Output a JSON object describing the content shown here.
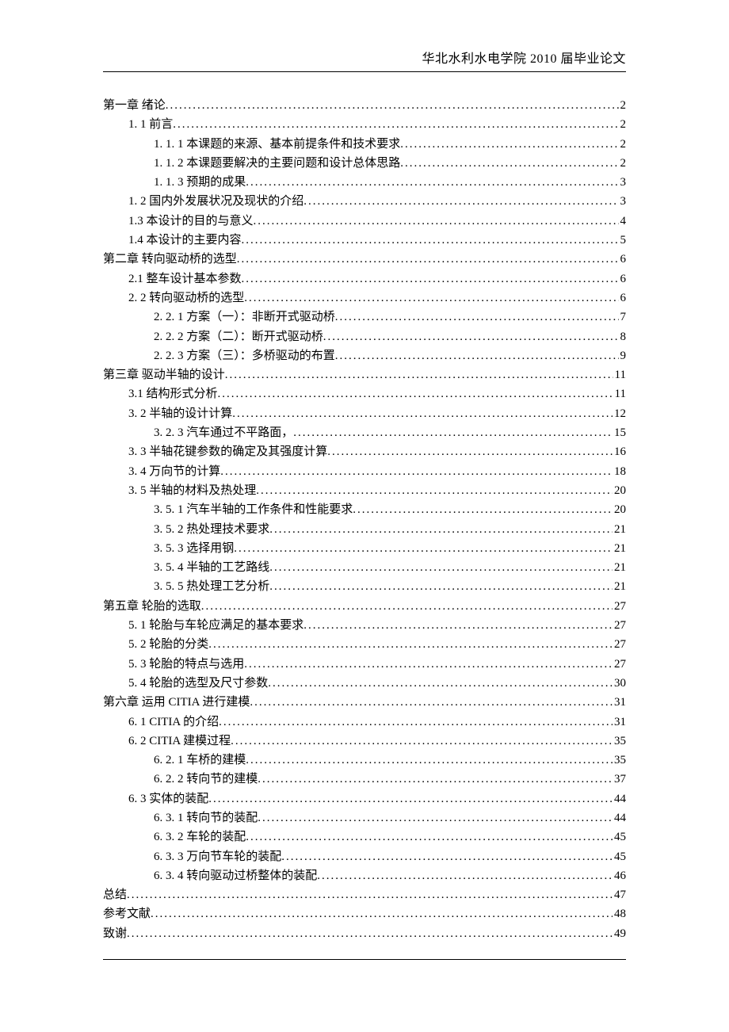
{
  "header": "华北水利水电学院 2010 届毕业论文",
  "toc": [
    {
      "level": 0,
      "label": "第一章  绪论",
      "page": "2"
    },
    {
      "level": 1,
      "label": "1. 1  前言",
      "page": "2"
    },
    {
      "level": 2,
      "label": "1. 1. 1  本课题的来源、基本前提条件和技术要求",
      "page": "2"
    },
    {
      "level": 2,
      "label": "1. 1. 2  本课题要解决的主要问题和设计总体思路",
      "page": "2"
    },
    {
      "level": 2,
      "label": "1. 1. 3  预期的成果",
      "page": "3"
    },
    {
      "level": 1,
      "label": "1. 2  国内外发展状况及现状的介绍",
      "page": "3"
    },
    {
      "level": 1,
      "label": "1.3  本设计的目的与意义",
      "page": "4"
    },
    {
      "level": 1,
      "label": "1.4  本设计的主要内容",
      "page": "5"
    },
    {
      "level": 0,
      "label": "第二章  转向驱动桥的选型",
      "page": "6"
    },
    {
      "level": 1,
      "label": "2.1 整车设计基本参数",
      "page": "6"
    },
    {
      "level": 1,
      "label": "2. 2  转向驱动桥的选型",
      "page": "6"
    },
    {
      "level": 2,
      "label": "2. 2. 1  方案（一）：非断开式驱动桥",
      "page": "7"
    },
    {
      "level": 2,
      "label": "2. 2. 2  方案（二）：断开式驱动桥",
      "page": "8"
    },
    {
      "level": 2,
      "label": "2. 2. 3  方案（三）：多桥驱动的布置",
      "page": "9"
    },
    {
      "level": 0,
      "label": "第三章   驱动半轴的设计",
      "page": "11"
    },
    {
      "level": 1,
      "label": "3.1 结构形式分析",
      "page": "11"
    },
    {
      "level": 1,
      "label": "3. 2 半轴的设计计算",
      "page": "12"
    },
    {
      "level": 2,
      "label": "3. 2. 3 汽车通过不平路面，",
      "page": "15"
    },
    {
      "level": 1,
      "label": "3. 3  半轴花键参数的确定及其强度计算",
      "page": "16"
    },
    {
      "level": 1,
      "label": "3. 4  万向节的计算",
      "page": "18"
    },
    {
      "level": 1,
      "label": "3. 5  半轴的材料及热处理",
      "page": "20"
    },
    {
      "level": 2,
      "label": "3. 5. 1  汽车半轴的工作条件和性能要求",
      "page": "20"
    },
    {
      "level": 2,
      "label": "3. 5. 2  热处理技术要求",
      "page": "21"
    },
    {
      "level": 2,
      "label": "3. 5. 3  选择用钢",
      "page": "21"
    },
    {
      "level": 2,
      "label": "3. 5. 4  半轴的工艺路线",
      "page": "21"
    },
    {
      "level": 2,
      "label": "3. 5. 5  热处理工艺分析",
      "page": "21"
    },
    {
      "level": 0,
      "label": "第五章  轮胎的选取",
      "page": "27"
    },
    {
      "level": 1,
      "label": "5. 1  轮胎与车轮应满足的基本要求",
      "page": "27"
    },
    {
      "level": 1,
      "label": "5. 2  轮胎的分类",
      "page": "27"
    },
    {
      "level": 1,
      "label": "5. 3  轮胎的特点与选用",
      "page": "27"
    },
    {
      "level": 1,
      "label": "5. 4  轮胎的选型及尺寸参数",
      "page": "30"
    },
    {
      "level": 0,
      "label": "第六章    运用 CITIA 进行建模",
      "page": "31"
    },
    {
      "level": 1,
      "label": "6. 1  CITIA 的介绍",
      "page": "31"
    },
    {
      "level": 1,
      "label": "6. 2  CITIA 建模过程",
      "page": "35"
    },
    {
      "level": 2,
      "label": "6. 2. 1  车桥的建模",
      "page": "35"
    },
    {
      "level": 2,
      "label": "6. 2. 2  转向节的建模",
      "page": "37"
    },
    {
      "level": 1,
      "label": "6. 3  实体的装配",
      "page": "44"
    },
    {
      "level": 2,
      "label": "6. 3. 1  转向节的装配",
      "page": "44"
    },
    {
      "level": 2,
      "label": "6. 3. 2  车轮的装配",
      "page": "45"
    },
    {
      "level": 2,
      "label": "6. 3. 3  万向节车轮的装配",
      "page": "45"
    },
    {
      "level": 2,
      "label": "6. 3. 4  转向驱动过桥整体的装配",
      "page": "46"
    },
    {
      "level": 0,
      "label": "总结",
      "page": "47"
    },
    {
      "level": 0,
      "label": "参考文献",
      "page": "48"
    },
    {
      "level": 0,
      "label": "致谢",
      "page": "49"
    }
  ]
}
